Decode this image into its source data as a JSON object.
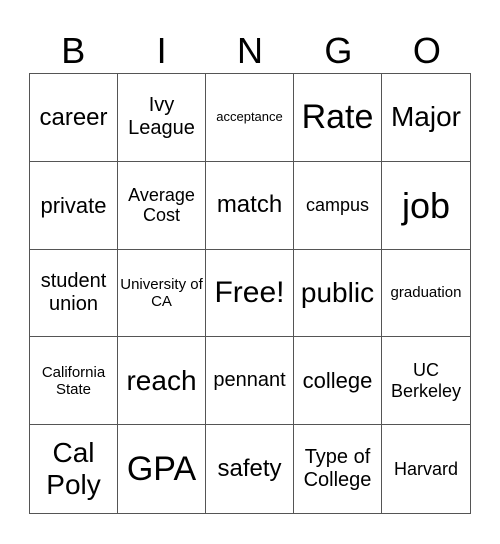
{
  "header": [
    "B",
    "I",
    "N",
    "G",
    "O"
  ],
  "cells": [
    "career",
    "Ivy League",
    "acceptance",
    "Rate",
    "Major",
    "private",
    "Average Cost",
    "match",
    "campus",
    "job",
    "student union",
    "University of CA",
    "Free!",
    "public",
    "graduation",
    "California State",
    "reach",
    "pennant",
    "college",
    "UC Berkeley",
    "Cal Poly",
    "GPA",
    "safety",
    "Type of College",
    "Harvard"
  ]
}
